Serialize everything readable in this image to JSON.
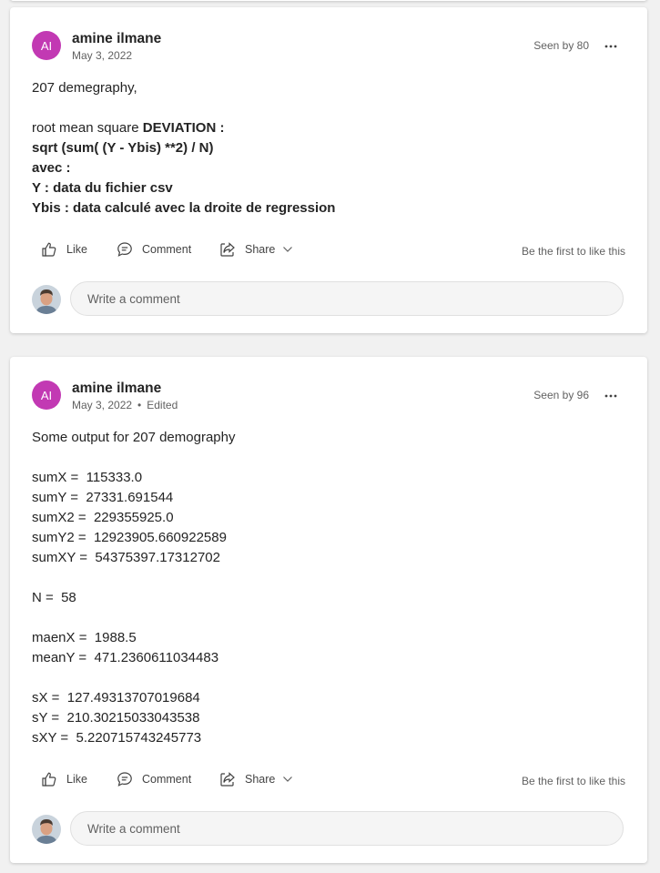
{
  "posts": [
    {
      "avatar_initials": "AI",
      "author": "amine ilmane",
      "date": "May 3, 2022",
      "edited": "",
      "seen_by": "Seen by 80",
      "body_lines": [
        [
          {
            "t": "207 demegraphy,",
            "b": false
          }
        ],
        [],
        [
          {
            "t": "root mean square ",
            "b": false
          },
          {
            "t": "DEVIATION :",
            "b": true
          }
        ],
        [
          {
            "t": "sqrt (sum( (Y - Ybis) **2) / N)",
            "b": true
          }
        ],
        [
          {
            "t": "avec :",
            "b": true
          }
        ],
        [
          {
            "t": "Y : data du fichier csv",
            "b": true
          }
        ],
        [
          {
            "t": "Ybis : data calculé avec la droite de regression",
            "b": true
          }
        ]
      ],
      "actions": {
        "like": "Like",
        "comment": "Comment",
        "share": "Share"
      },
      "be_first": "Be the first to like this",
      "comment_placeholder": "Write a comment"
    },
    {
      "avatar_initials": "AI",
      "author": "amine ilmane",
      "date": "May 3, 2022",
      "edited": "Edited",
      "seen_by": "Seen by 96",
      "body_lines": [
        [
          {
            "t": "Some output for 207 demography",
            "b": false
          }
        ],
        [],
        [
          {
            "t": "sumX =  115333.0",
            "b": false
          }
        ],
        [
          {
            "t": "sumY =  27331.691544",
            "b": false
          }
        ],
        [
          {
            "t": "sumX2 =  229355925.0",
            "b": false
          }
        ],
        [
          {
            "t": "sumY2 =  12923905.660922589",
            "b": false
          }
        ],
        [
          {
            "t": "sumXY =  54375397.17312702",
            "b": false
          }
        ],
        [],
        [
          {
            "t": "N =  58",
            "b": false
          }
        ],
        [],
        [
          {
            "t": "maenX =  1988.5",
            "b": false
          }
        ],
        [
          {
            "t": "meanY =  471.2360611034483",
            "b": false
          }
        ],
        [],
        [
          {
            "t": "sX =  127.49313707019684",
            "b": false
          }
        ],
        [
          {
            "t": "sY =  210.30215033043538",
            "b": false
          }
        ],
        [
          {
            "t": "sXY =  5.220715743245773",
            "b": false
          }
        ]
      ],
      "actions": {
        "like": "Like",
        "comment": "Comment",
        "share": "Share"
      },
      "be_first": "Be the first to like this",
      "comment_placeholder": "Write a comment"
    }
  ],
  "icons": {
    "like": "thumbs-up-icon",
    "comment": "speech-bubble-icon",
    "share": "share-arrow-icon",
    "share_menu": "chevron-down-icon",
    "more": "ellipsis-icon"
  },
  "colors": {
    "avatar_bg": "#c239b3",
    "page_bg": "#f1f1f1",
    "card_bg": "#ffffff"
  }
}
